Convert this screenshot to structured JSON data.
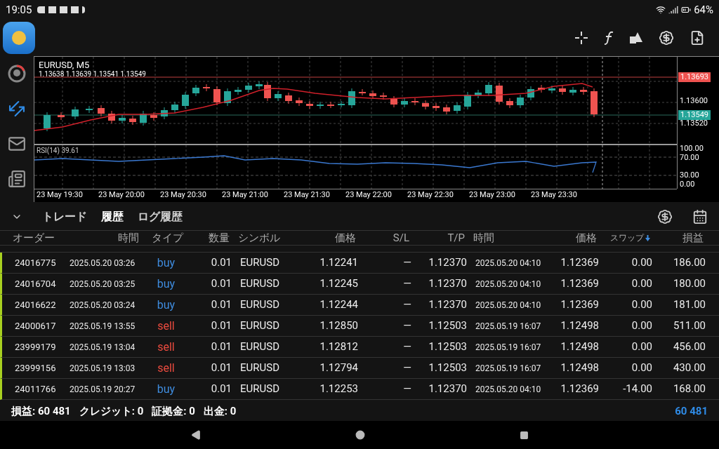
{
  "status_bar": {
    "time": "19:05",
    "battery": "64%"
  },
  "chart": {
    "symbol": "EURUSD, M5",
    "ohlc": "1.13638 1.13639 1.13541 1.13549",
    "ask_label": "1.13693",
    "bid_label": "1.13549",
    "price_ticks": [
      "1.13600",
      "1.13520"
    ],
    "indicator": "RSI(14) 39.61",
    "indicator_ticks": [
      "100.00",
      "70.00",
      "30.00",
      "0.00"
    ],
    "time_ticks": [
      "23 May 19:30",
      "23 May 20:00",
      "23 May 20:30",
      "23 May 21:00",
      "23 May 21:30",
      "23 May 22:00",
      "23 May 22:30",
      "23 May 23:00",
      "23 May 23:30"
    ]
  },
  "tabs": [
    {
      "label": "トレード",
      "selected": false
    },
    {
      "label": "履歴",
      "selected": true
    },
    {
      "label": "ログ履歴",
      "selected": false
    }
  ],
  "table": {
    "columns": [
      {
        "label": "オーダー",
        "sorted": false
      },
      {
        "label": "時間",
        "sorted": false
      },
      {
        "label": "タイプ",
        "sorted": false
      },
      {
        "label": "数量",
        "sorted": false
      },
      {
        "label": "シンボル",
        "sorted": false
      },
      {
        "label": "価格",
        "sorted": false
      },
      {
        "label": "S/L",
        "sorted": false
      },
      {
        "label": "T/P",
        "sorted": false
      },
      {
        "label": "時間",
        "sorted": false
      },
      {
        "label": "価格",
        "sorted": false
      },
      {
        "label": "スワップ",
        "sorted": true
      },
      {
        "label": "損益",
        "sorted": false
      }
    ],
    "rows": [
      {
        "kind": "buy",
        "cells": [
          "24016775",
          "2025.05.20 03:26",
          "buy",
          "0.01",
          "EURUSD",
          "1.12241",
          "—",
          "1.12370",
          "2025.05.20 04:10",
          "1.12369",
          "0.00",
          "186.00"
        ]
      },
      {
        "kind": "buy",
        "cells": [
          "24016704",
          "2025.05.20 03:25",
          "buy",
          "0.01",
          "EURUSD",
          "1.12245",
          "—",
          "1.12370",
          "2025.05.20 04:10",
          "1.12369",
          "0.00",
          "180.00"
        ]
      },
      {
        "kind": "buy",
        "cells": [
          "24016622",
          "2025.05.20 03:24",
          "buy",
          "0.01",
          "EURUSD",
          "1.12244",
          "—",
          "1.12370",
          "2025.05.20 04:10",
          "1.12369",
          "0.00",
          "181.00"
        ]
      },
      {
        "kind": "sell",
        "cells": [
          "24000617",
          "2025.05.19 13:55",
          "sell",
          "0.01",
          "EURUSD",
          "1.12850",
          "—",
          "1.12503",
          "2025.05.19 16:07",
          "1.12498",
          "0.00",
          "511.00"
        ]
      },
      {
        "kind": "sell",
        "cells": [
          "23999179",
          "2025.05.19 13:04",
          "sell",
          "0.01",
          "EURUSD",
          "1.12812",
          "—",
          "1.12503",
          "2025.05.19 16:07",
          "1.12498",
          "0.00",
          "456.00"
        ]
      },
      {
        "kind": "sell",
        "cells": [
          "23999156",
          "2025.05.19 13:03",
          "sell",
          "0.01",
          "EURUSD",
          "1.12794",
          "—",
          "1.12503",
          "2025.05.19 16:07",
          "1.12498",
          "0.00",
          "430.00"
        ]
      },
      {
        "kind": "buy",
        "cells": [
          "24011766",
          "2025.05.19 20:27",
          "buy",
          "0.01",
          "EURUSD",
          "1.12253",
          "—",
          "1.12370",
          "2025.05.20 04:10",
          "1.12369",
          "-14.00",
          "168.00"
        ]
      }
    ]
  },
  "summary": {
    "items": [
      "損益: 60 481",
      "クレジット: 0",
      "証拠金: 0",
      "出金: 0"
    ],
    "total": "60 481"
  }
}
